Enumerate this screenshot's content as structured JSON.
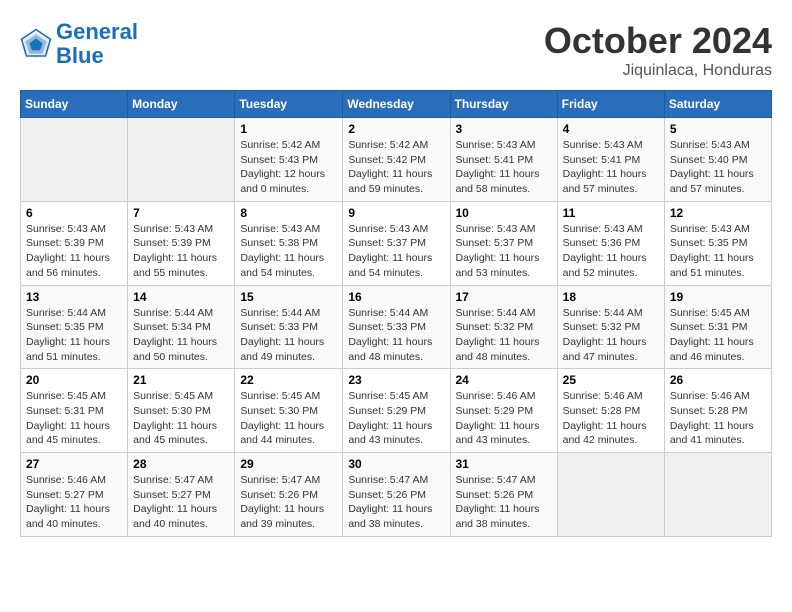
{
  "header": {
    "logo_line1": "General",
    "logo_line2": "Blue",
    "title": "October 2024",
    "subtitle": "Jiquinlaca, Honduras"
  },
  "days_of_week": [
    "Sunday",
    "Monday",
    "Tuesday",
    "Wednesday",
    "Thursday",
    "Friday",
    "Saturday"
  ],
  "weeks": [
    [
      {
        "day": "",
        "empty": true
      },
      {
        "day": "",
        "empty": true
      },
      {
        "day": "1",
        "sunrise": "5:42 AM",
        "sunset": "5:43 PM",
        "daylight": "12 hours and 0 minutes."
      },
      {
        "day": "2",
        "sunrise": "5:42 AM",
        "sunset": "5:42 PM",
        "daylight": "11 hours and 59 minutes."
      },
      {
        "day": "3",
        "sunrise": "5:43 AM",
        "sunset": "5:41 PM",
        "daylight": "11 hours and 58 minutes."
      },
      {
        "day": "4",
        "sunrise": "5:43 AM",
        "sunset": "5:41 PM",
        "daylight": "11 hours and 57 minutes."
      },
      {
        "day": "5",
        "sunrise": "5:43 AM",
        "sunset": "5:40 PM",
        "daylight": "11 hours and 57 minutes."
      }
    ],
    [
      {
        "day": "6",
        "sunrise": "5:43 AM",
        "sunset": "5:39 PM",
        "daylight": "11 hours and 56 minutes."
      },
      {
        "day": "7",
        "sunrise": "5:43 AM",
        "sunset": "5:39 PM",
        "daylight": "11 hours and 55 minutes."
      },
      {
        "day": "8",
        "sunrise": "5:43 AM",
        "sunset": "5:38 PM",
        "daylight": "11 hours and 54 minutes."
      },
      {
        "day": "9",
        "sunrise": "5:43 AM",
        "sunset": "5:37 PM",
        "daylight": "11 hours and 54 minutes."
      },
      {
        "day": "10",
        "sunrise": "5:43 AM",
        "sunset": "5:37 PM",
        "daylight": "11 hours and 53 minutes."
      },
      {
        "day": "11",
        "sunrise": "5:43 AM",
        "sunset": "5:36 PM",
        "daylight": "11 hours and 52 minutes."
      },
      {
        "day": "12",
        "sunrise": "5:43 AM",
        "sunset": "5:35 PM",
        "daylight": "11 hours and 51 minutes."
      }
    ],
    [
      {
        "day": "13",
        "sunrise": "5:44 AM",
        "sunset": "5:35 PM",
        "daylight": "11 hours and 51 minutes."
      },
      {
        "day": "14",
        "sunrise": "5:44 AM",
        "sunset": "5:34 PM",
        "daylight": "11 hours and 50 minutes."
      },
      {
        "day": "15",
        "sunrise": "5:44 AM",
        "sunset": "5:33 PM",
        "daylight": "11 hours and 49 minutes."
      },
      {
        "day": "16",
        "sunrise": "5:44 AM",
        "sunset": "5:33 PM",
        "daylight": "11 hours and 48 minutes."
      },
      {
        "day": "17",
        "sunrise": "5:44 AM",
        "sunset": "5:32 PM",
        "daylight": "11 hours and 48 minutes."
      },
      {
        "day": "18",
        "sunrise": "5:44 AM",
        "sunset": "5:32 PM",
        "daylight": "11 hours and 47 minutes."
      },
      {
        "day": "19",
        "sunrise": "5:45 AM",
        "sunset": "5:31 PM",
        "daylight": "11 hours and 46 minutes."
      }
    ],
    [
      {
        "day": "20",
        "sunrise": "5:45 AM",
        "sunset": "5:31 PM",
        "daylight": "11 hours and 45 minutes."
      },
      {
        "day": "21",
        "sunrise": "5:45 AM",
        "sunset": "5:30 PM",
        "daylight": "11 hours and 45 minutes."
      },
      {
        "day": "22",
        "sunrise": "5:45 AM",
        "sunset": "5:30 PM",
        "daylight": "11 hours and 44 minutes."
      },
      {
        "day": "23",
        "sunrise": "5:45 AM",
        "sunset": "5:29 PM",
        "daylight": "11 hours and 43 minutes."
      },
      {
        "day": "24",
        "sunrise": "5:46 AM",
        "sunset": "5:29 PM",
        "daylight": "11 hours and 43 minutes."
      },
      {
        "day": "25",
        "sunrise": "5:46 AM",
        "sunset": "5:28 PM",
        "daylight": "11 hours and 42 minutes."
      },
      {
        "day": "26",
        "sunrise": "5:46 AM",
        "sunset": "5:28 PM",
        "daylight": "11 hours and 41 minutes."
      }
    ],
    [
      {
        "day": "27",
        "sunrise": "5:46 AM",
        "sunset": "5:27 PM",
        "daylight": "11 hours and 40 minutes."
      },
      {
        "day": "28",
        "sunrise": "5:47 AM",
        "sunset": "5:27 PM",
        "daylight": "11 hours and 40 minutes."
      },
      {
        "day": "29",
        "sunrise": "5:47 AM",
        "sunset": "5:26 PM",
        "daylight": "11 hours and 39 minutes."
      },
      {
        "day": "30",
        "sunrise": "5:47 AM",
        "sunset": "5:26 PM",
        "daylight": "11 hours and 38 minutes."
      },
      {
        "day": "31",
        "sunrise": "5:47 AM",
        "sunset": "5:26 PM",
        "daylight": "11 hours and 38 minutes."
      },
      {
        "day": "",
        "empty": true
      },
      {
        "day": "",
        "empty": true
      }
    ]
  ],
  "labels": {
    "sunrise": "Sunrise:",
    "sunset": "Sunset:",
    "daylight": "Daylight:"
  }
}
